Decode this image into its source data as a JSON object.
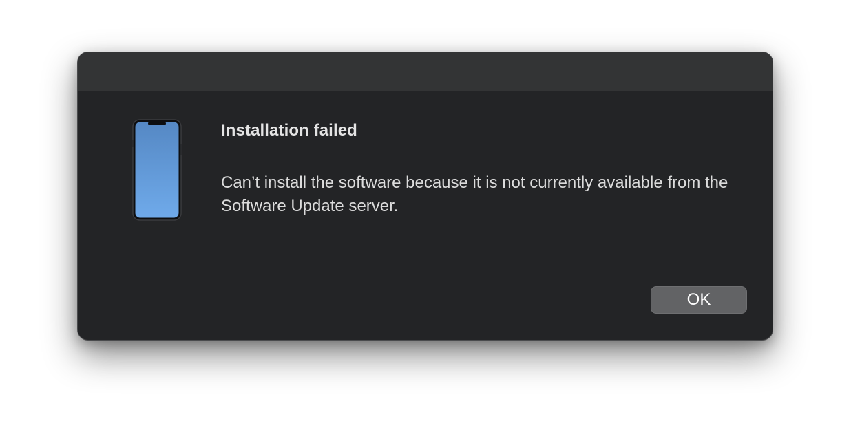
{
  "dialog": {
    "title": "Installation failed",
    "message": "Can’t install the software because it is not currently available from the Software Update server.",
    "ok_label": "OK",
    "icon": "iphone-icon"
  },
  "colors": {
    "background": "#232426",
    "titlebar": "#333435",
    "button": "#626365",
    "screen_top": "#5588c4",
    "screen_bottom": "#6faaea"
  }
}
